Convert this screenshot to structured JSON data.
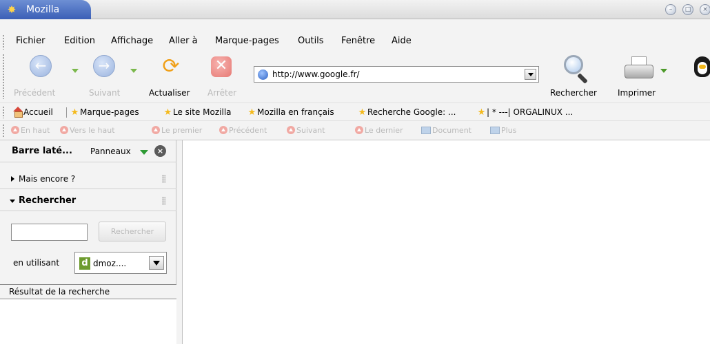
{
  "window": {
    "title": "Mozilla",
    "app_icon": "mozilla-icon",
    "buttons": [
      "minimize",
      "maximize",
      "close"
    ]
  },
  "menu": {
    "items": [
      "Fichier",
      "Edition",
      "Affichage",
      "Aller à",
      "Marque-pages",
      "Outils",
      "Fenêtre",
      "Aide"
    ]
  },
  "nav": {
    "back_label": "Précédent",
    "forward_label": "Suivant",
    "reload_label": "Actualiser",
    "stop_label": "Arrêter",
    "url": "http://www.google.fr/",
    "search_label": "Rechercher",
    "print_label": "Imprimer"
  },
  "personal_toolbar": {
    "items": [
      "Accueil",
      "Marque-pages",
      "Le site Mozilla",
      "Mozilla en français",
      "Recherche Google: ...",
      "| * ---| ORGALINUX ..."
    ]
  },
  "site_navigation": {
    "items": [
      "En haut",
      "Vers le haut",
      "Le premier",
      "Précédent",
      "Suivant",
      "Le dernier",
      "Document",
      "Plus"
    ]
  },
  "sidebar": {
    "title": "Barre laté...",
    "panels_label": "Panneaux",
    "sections": [
      "Mais encore ?",
      "Rechercher"
    ],
    "search_button": "Rechercher",
    "search_input_value": "",
    "using_label": "en utilisant",
    "engine": "dmoz....",
    "results_label": "Résultat de la recherche"
  },
  "colors": {
    "title_blue": "#3b5fb6",
    "toolbar_bg": "#f3f3f3",
    "dropdown_green": "#7bb84c",
    "disabled_text": "#b9b9b9"
  }
}
